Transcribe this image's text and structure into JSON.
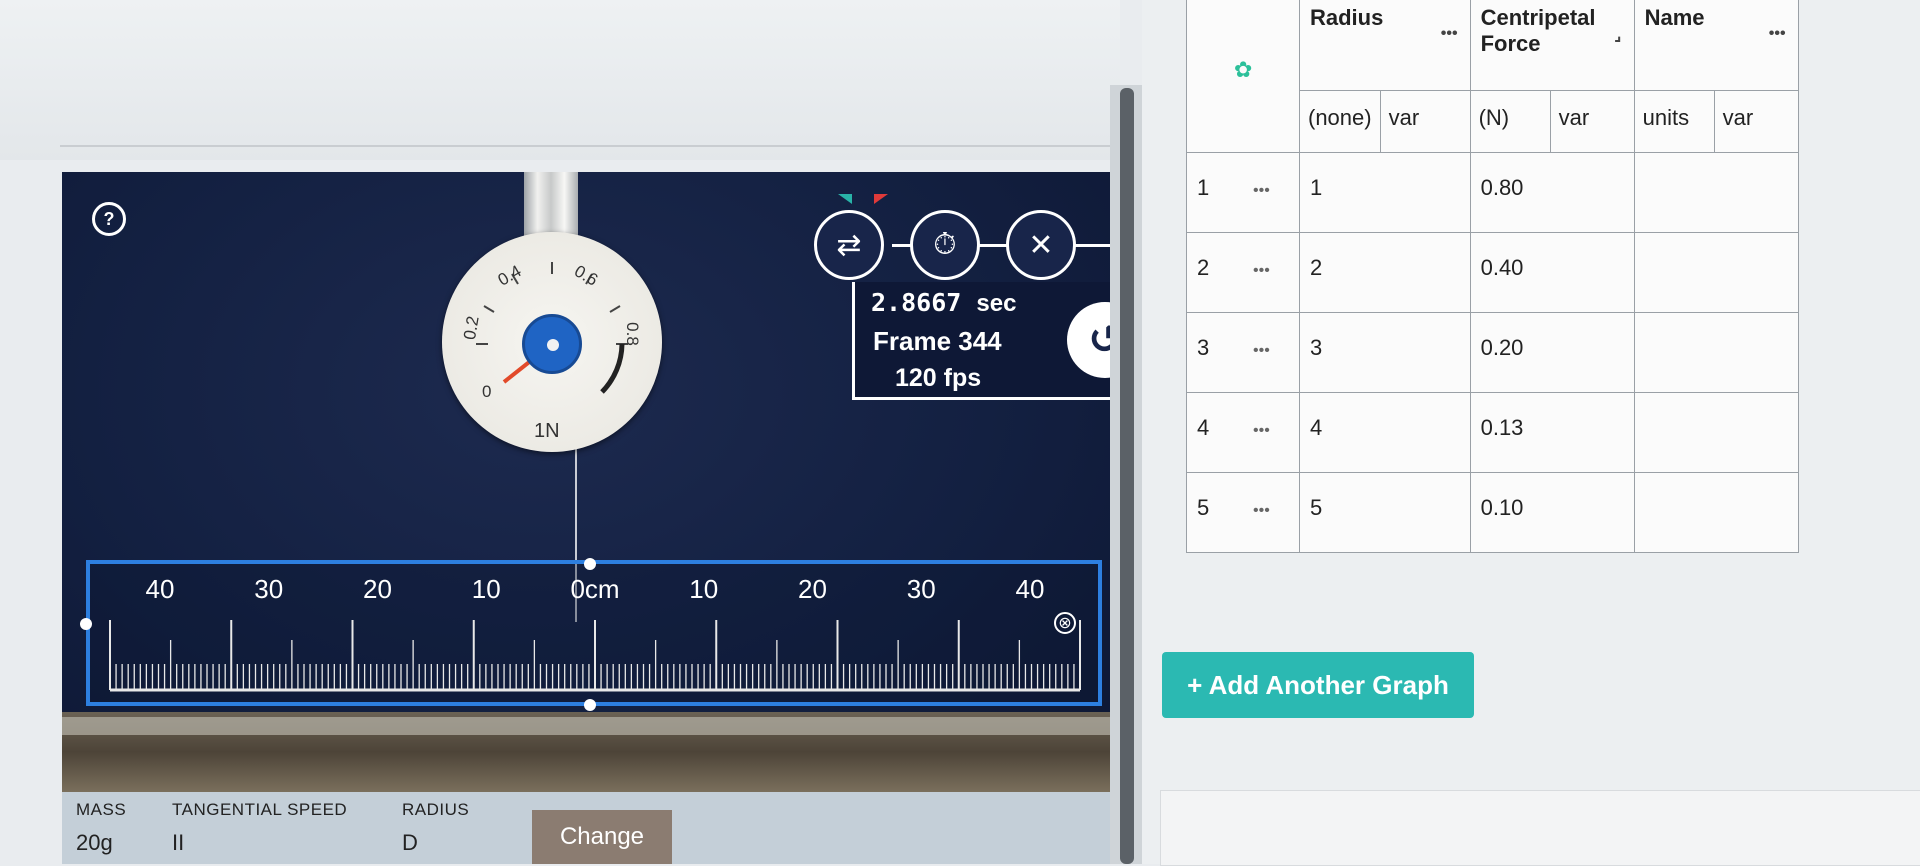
{
  "video": {
    "help_label": "?",
    "gauge": {
      "labels": [
        "0",
        "0.2",
        "0.4",
        "0.6",
        "0.8"
      ],
      "unit": "1N"
    },
    "readout": {
      "time": "2.8667",
      "time_unit": "sec",
      "frame": "Frame 344",
      "fps": "120 fps"
    },
    "tools": [
      "ruler-toggle-icon",
      "stopwatch-icon",
      "tools-icon",
      "replay-icon"
    ],
    "ruler": {
      "ticks": [
        "40",
        "30",
        "20",
        "10",
        "0cm",
        "10",
        "20",
        "30",
        "40"
      ]
    }
  },
  "controls": {
    "mass_label": "MASS",
    "mass_value": "20g",
    "speed_label": "TANGENTIAL SPEED",
    "speed_value": "II",
    "radius_label": "RADIUS",
    "radius_value": "D",
    "change_label": "Change"
  },
  "table": {
    "columns": [
      {
        "name": "Radius",
        "unit": "(none)",
        "var": "var",
        "has_dots": true
      },
      {
        "name": "Centripetal Force",
        "unit": "(N)",
        "var": "var",
        "has_dots": true
      },
      {
        "name": "Name",
        "unit": "units",
        "var": "var",
        "has_dots": true
      }
    ],
    "rows": [
      {
        "index": "1",
        "radius": "1",
        "force": "0.80",
        "name": ""
      },
      {
        "index": "2",
        "radius": "2",
        "force": "0.40",
        "name": ""
      },
      {
        "index": "3",
        "radius": "3",
        "force": "0.20",
        "name": ""
      },
      {
        "index": "4",
        "radius": "4",
        "force": "0.13",
        "name": ""
      },
      {
        "index": "5",
        "radius": "5",
        "force": "0.10",
        "name": ""
      }
    ],
    "row_dots": "•••",
    "header_dots": "•••"
  },
  "add_graph_label": "+ Add Another Graph",
  "colors": {
    "accent_teal": "#2bb9b2",
    "ruler_blue": "#2d7fe0",
    "gear_green": "#2cc09a",
    "video_bg": "#132041"
  }
}
